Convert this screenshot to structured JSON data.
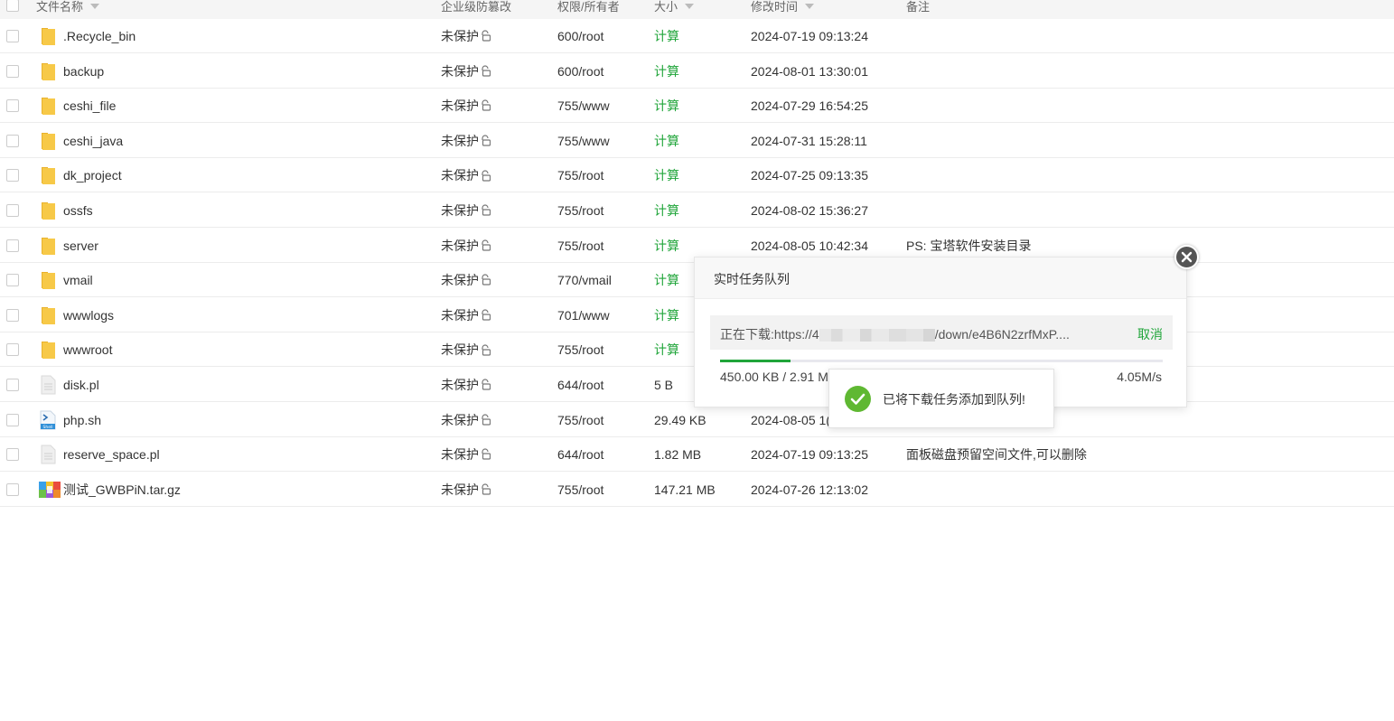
{
  "header": {
    "name": "文件名称",
    "protection": "企业级防篡改",
    "perm": "权限/所有者",
    "size": "大小",
    "mtime": "修改时间",
    "remark": "备注"
  },
  "files": [
    {
      "name": ".Recycle_bin",
      "icon": "folder-icon",
      "protection": "未保护",
      "perm": "600/root",
      "size": "计算",
      "size_is_link": true,
      "mtime": "2024-07-19 09:13:24",
      "remark": ""
    },
    {
      "name": "backup",
      "icon": "folder-icon",
      "protection": "未保护",
      "perm": "600/root",
      "size": "计算",
      "size_is_link": true,
      "mtime": "2024-08-01 13:30:01",
      "remark": ""
    },
    {
      "name": "ceshi_file",
      "icon": "folder-icon",
      "protection": "未保护",
      "perm": "755/www",
      "size": "计算",
      "size_is_link": true,
      "mtime": "2024-07-29 16:54:25",
      "remark": ""
    },
    {
      "name": "ceshi_java",
      "icon": "folder-icon",
      "protection": "未保护",
      "perm": "755/www",
      "size": "计算",
      "size_is_link": true,
      "mtime": "2024-07-31 15:28:11",
      "remark": ""
    },
    {
      "name": "dk_project",
      "icon": "folder-icon",
      "protection": "未保护",
      "perm": "755/root",
      "size": "计算",
      "size_is_link": true,
      "mtime": "2024-07-25 09:13:35",
      "remark": ""
    },
    {
      "name": "ossfs",
      "icon": "folder-icon",
      "protection": "未保护",
      "perm": "755/root",
      "size": "计算",
      "size_is_link": true,
      "mtime": "2024-08-02 15:36:27",
      "remark": ""
    },
    {
      "name": "server",
      "icon": "folder-icon",
      "protection": "未保护",
      "perm": "755/root",
      "size": "计算",
      "size_is_link": true,
      "mtime": "2024-08-05 10:42:34",
      "remark": "PS: 宝塔软件安装目录"
    },
    {
      "name": "vmail",
      "icon": "folder-icon",
      "protection": "未保护",
      "perm": "770/vmail",
      "size": "计算",
      "size_is_link": true,
      "mtime": "",
      "remark": ""
    },
    {
      "name": "wwwlogs",
      "icon": "folder-icon",
      "protection": "未保护",
      "perm": "701/www",
      "size": "计算",
      "size_is_link": true,
      "mtime": "",
      "remark": ""
    },
    {
      "name": "wwwroot",
      "icon": "folder-icon",
      "protection": "未保护",
      "perm": "755/root",
      "size": "计算",
      "size_is_link": true,
      "mtime": "",
      "remark": ""
    },
    {
      "name": "disk.pl",
      "icon": "file-icon",
      "protection": "未保护",
      "perm": "644/root",
      "size": "5 B",
      "size_is_link": false,
      "mtime": "",
      "remark": ""
    },
    {
      "name": "php.sh",
      "icon": "script-icon",
      "protection": "未保护",
      "perm": "755/root",
      "size": "29.49 KB",
      "size_is_link": false,
      "mtime": "2024-08-05 1(",
      "remark": ""
    },
    {
      "name": "reserve_space.pl",
      "icon": "file-icon",
      "protection": "未保护",
      "perm": "644/root",
      "size": "1.82 MB",
      "size_is_link": false,
      "mtime": "2024-07-19 09:13:25",
      "remark": "面板磁盘预留空间文件,可以删除"
    },
    {
      "name": "测试_GWBPiN.tar.gz",
      "icon": "archive-icon",
      "protection": "未保护",
      "perm": "755/root",
      "size": "147.21 MB",
      "size_is_link": false,
      "mtime": "2024-07-26 12:13:02",
      "remark": ""
    }
  ],
  "task_panel": {
    "title": "实时任务队列",
    "task_prefix": "正在下载:https://4",
    "task_suffix": "/down/e4B6N2zrfMxP....",
    "cancel_label": "取消",
    "progress_fraction": 0.16,
    "bytes_text": "450.00 KB / 2.91 MB",
    "speed": "4.05M/s"
  },
  "toast": {
    "message": "已将下载任务添加到队列!"
  },
  "colors": {
    "accent_green": "#20a53a",
    "folder_yellow": "#f7c948"
  }
}
